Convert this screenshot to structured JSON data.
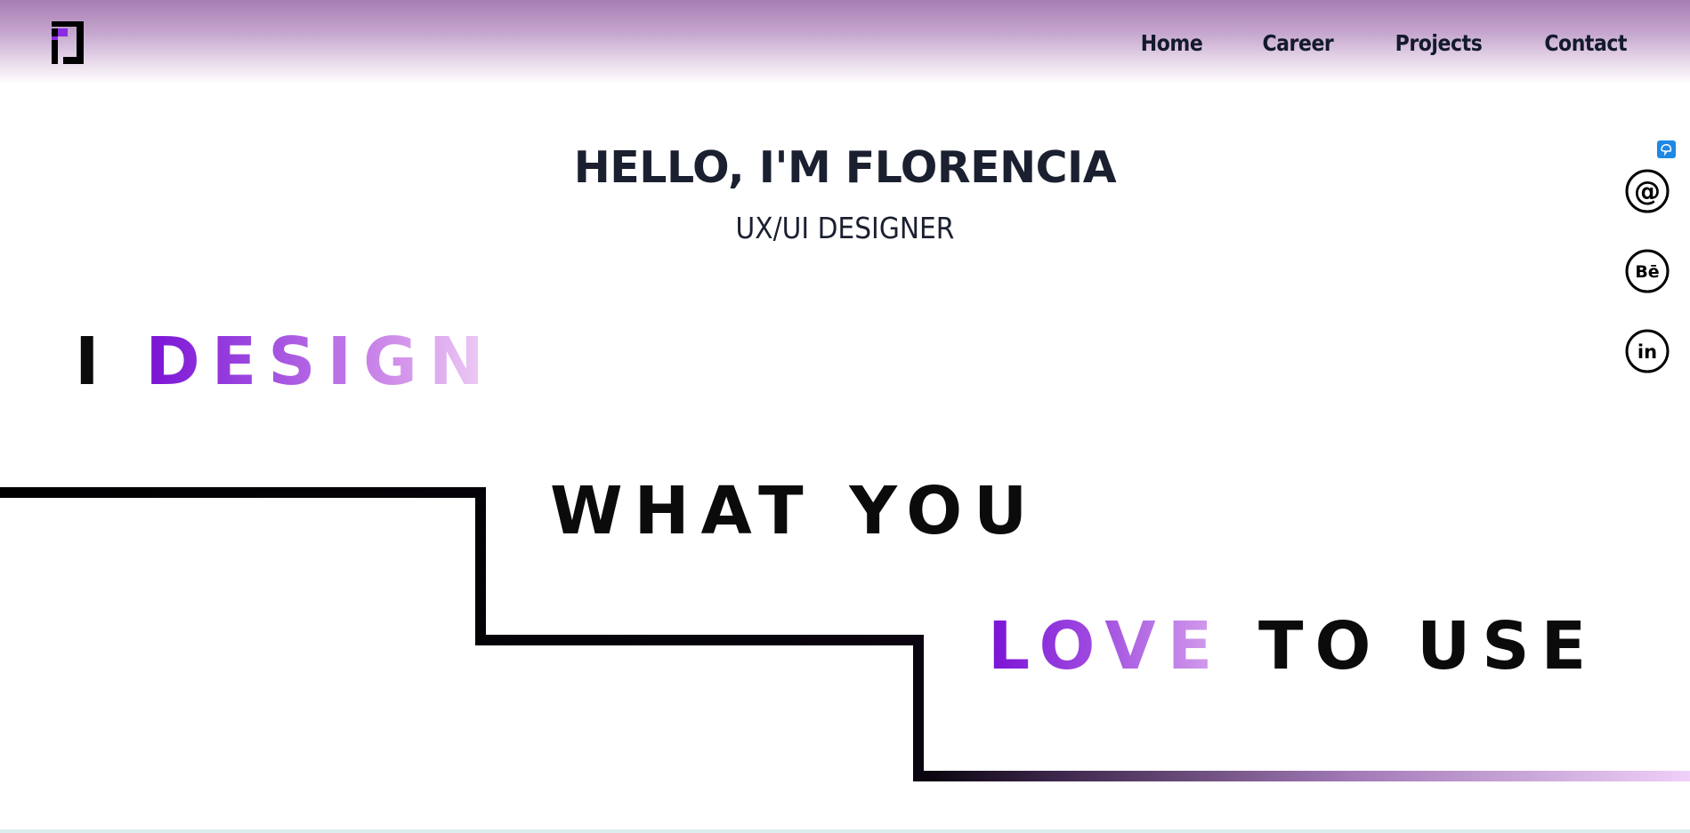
{
  "header": {
    "logo_icon": "brand-logo-icon",
    "nav": [
      {
        "label": "Home"
      },
      {
        "label": "Career"
      },
      {
        "label": "Projects"
      },
      {
        "label": "Contact"
      }
    ]
  },
  "hero": {
    "title": "HELLO, I'M FLORENCIA",
    "subtitle": "UX/UI DESIGNER"
  },
  "tagline": {
    "line1_prefix": "I",
    "line1_highlight": "DESIGN",
    "line2": "WHAT YOU",
    "line3_highlight": "LOVE",
    "line3_suffix": "TO USE"
  },
  "social": [
    {
      "icon": "email-icon"
    },
    {
      "icon": "behance-icon"
    },
    {
      "icon": "linkedin-icon"
    }
  ],
  "colors": {
    "text_dark": "#1a2030",
    "accent_purple": "#7a12d6",
    "accent_light": "#f1d4f6",
    "header_top": "#a87db4"
  }
}
